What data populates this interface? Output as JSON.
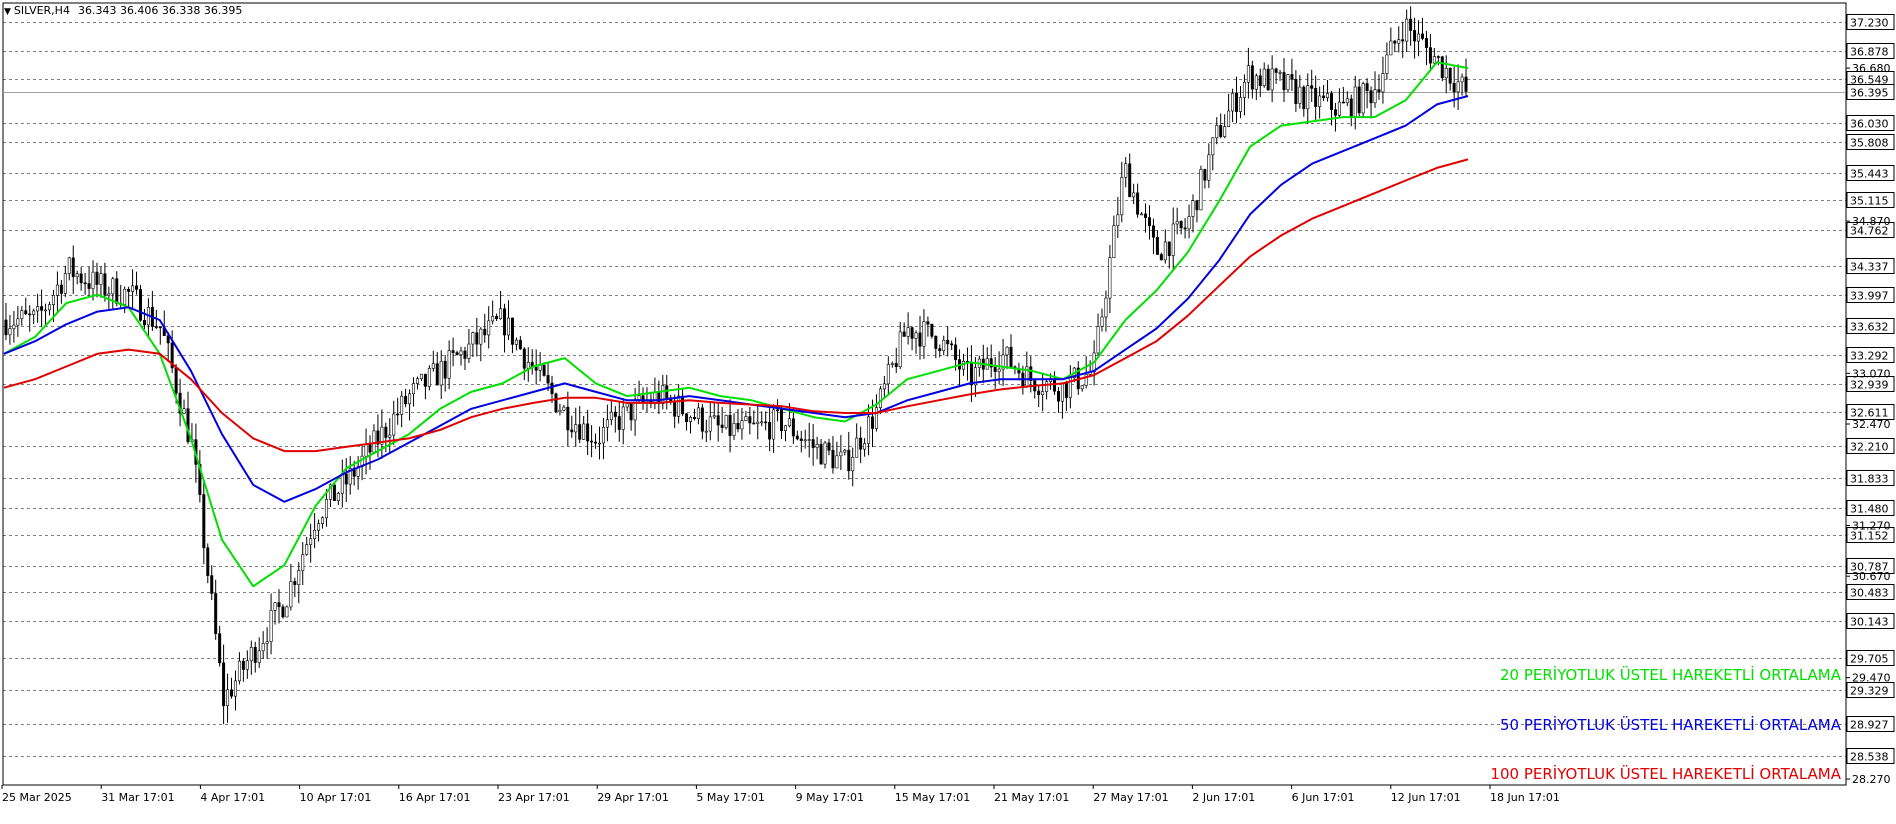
{
  "header": {
    "symbol": "SILVER,H4",
    "ohlc": "36.343 36.406 36.338 36.395"
  },
  "colors": {
    "background": "#ffffff",
    "candle": "#000000",
    "grid": "#000000",
    "ema20": "#00e000",
    "ema50": "#0000e0",
    "ema100": "#e00000",
    "current_price_line": "#a0a0a0"
  },
  "chart_data": {
    "type": "candlestick",
    "instrument": "SILVER",
    "timeframe": "H4",
    "y_range": [
      28.2,
      37.45
    ],
    "grid": "horizontal dashed at labeled levels",
    "legend_placement": "bottom-right",
    "x_labels": [
      "25 Mar 2025",
      "31 Mar 17:01",
      "4 Apr 17:01",
      "10 Apr 17:01",
      "16 Apr 17:01",
      "23 Apr 17:01",
      "29 Apr 17:01",
      "5 May 17:01",
      "9 May 17:01",
      "15 May 17:01",
      "21 May 17:01",
      "27 May 17:01",
      "2 Jun 17:01",
      "6 Jun 17:01",
      "12 Jun 17:01",
      "18 Jun 17:01"
    ],
    "price_levels_boxed": [
      37.23,
      36.878,
      36.549,
      36.395,
      36.03,
      35.808,
      35.443,
      35.115,
      34.762,
      34.337,
      33.997,
      33.632,
      33.292,
      32.939,
      32.611,
      32.21,
      31.833,
      31.48,
      31.152,
      30.787,
      30.483,
      30.143,
      29.705,
      29.329,
      28.927,
      28.538
    ],
    "price_scale_ticks": [
      36.68,
      34.87,
      33.07,
      32.47,
      31.27,
      30.67,
      29.47,
      28.27
    ],
    "current_price": 36.395,
    "series": [
      {
        "name": "20 PERİYOTLUK ÜSTEL HAREKETLİ ORTALAMA",
        "color": "#00e000",
        "values": [
          33.3,
          33.5,
          33.9,
          34.0,
          33.85,
          33.3,
          32.3,
          31.1,
          30.55,
          30.8,
          31.5,
          31.95,
          32.15,
          32.35,
          32.65,
          32.85,
          32.95,
          33.15,
          33.25,
          32.95,
          32.8,
          32.85,
          32.9,
          32.8,
          32.75,
          32.65,
          32.55,
          32.5,
          32.7,
          33.0,
          33.1,
          33.2,
          33.15,
          33.1,
          33.0,
          33.2,
          33.7,
          34.05,
          34.5,
          35.1,
          35.75,
          36.0,
          36.05,
          36.1,
          36.1,
          36.3,
          36.75,
          36.68
        ]
      },
      {
        "name": "50 PERİYOTLUK ÜSTEL HAREKETLİ ORTALAMA",
        "color": "#0000e0",
        "values": [
          33.3,
          33.45,
          33.65,
          33.8,
          33.85,
          33.7,
          33.1,
          32.35,
          31.75,
          31.55,
          31.7,
          31.9,
          32.05,
          32.25,
          32.45,
          32.65,
          32.75,
          32.85,
          32.95,
          32.85,
          32.75,
          32.75,
          32.8,
          32.75,
          32.7,
          32.65,
          32.6,
          32.55,
          32.6,
          32.75,
          32.85,
          32.95,
          33.0,
          33.0,
          33.0,
          33.1,
          33.35,
          33.6,
          33.95,
          34.4,
          34.95,
          35.3,
          35.55,
          35.7,
          35.85,
          36.0,
          36.25,
          36.35
        ]
      },
      {
        "name": "100 PERİYOTLUK ÜSTEL HAREKETLİ ORTALAMA",
        "color": "#e00000",
        "values": [
          32.9,
          33.0,
          33.15,
          33.3,
          33.35,
          33.3,
          33.0,
          32.6,
          32.3,
          32.15,
          32.15,
          32.2,
          32.25,
          32.3,
          32.4,
          32.55,
          32.65,
          32.72,
          32.78,
          32.78,
          32.72,
          32.72,
          32.75,
          32.72,
          32.7,
          32.68,
          32.62,
          32.6,
          32.6,
          32.68,
          32.75,
          32.82,
          32.88,
          32.92,
          32.95,
          33.05,
          33.25,
          33.45,
          33.75,
          34.1,
          34.45,
          34.7,
          34.9,
          35.05,
          35.2,
          35.35,
          35.5,
          35.6
        ]
      }
    ],
    "price_path": [
      33.7,
      33.7,
      34.3,
      34.1,
      34.0,
      33.6,
      32.2,
      29.2,
      29.8,
      30.4,
      31.4,
      31.8,
      32.3,
      32.8,
      33.1,
      33.4,
      33.7,
      33.1,
      32.6,
      32.3,
      32.6,
      32.8,
      32.6,
      32.4,
      32.4,
      32.5,
      32.2,
      32.0,
      32.6,
      33.6,
      33.5,
      33.0,
      33.3,
      33.0,
      32.9,
      33.1,
      35.5,
      34.5,
      34.8,
      35.9,
      36.6,
      36.5,
      36.3,
      36.2,
      36.4,
      37.2,
      36.8,
      36.4
    ]
  }
}
